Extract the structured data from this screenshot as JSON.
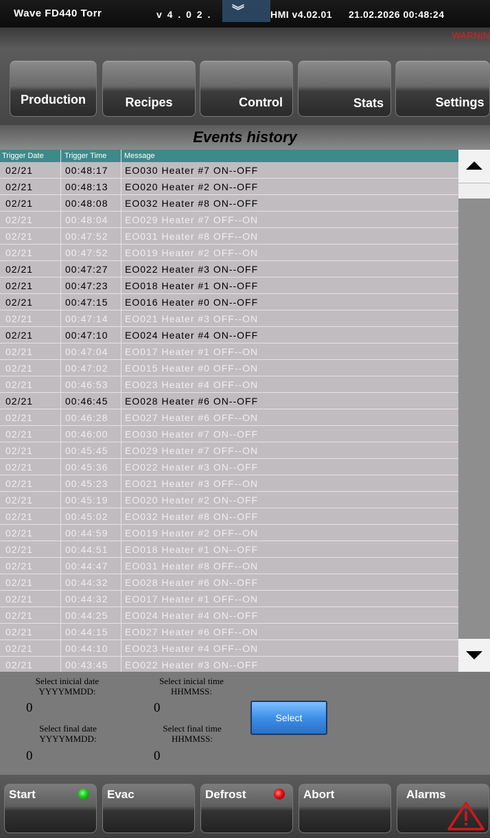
{
  "header": {
    "app_title": "Wave FD440 Torr",
    "version": "v 4 .   0 2 .",
    "hmi_version": "HMI v4.02.01",
    "datetime": "21.02.2026 00:48:24",
    "warning": "WARNIN"
  },
  "nav": {
    "production": "Production",
    "recipes": "Recipes",
    "control": "Control",
    "stats": "Stats",
    "settings": "Settings"
  },
  "page_title": "Events history",
  "table": {
    "columns": [
      "Trigger Date",
      "Trigger Time",
      "Message"
    ],
    "rows": [
      {
        "date": "02/21",
        "time": "00:48:17",
        "message": "EO030 Heater #7 ON--OFF",
        "state": "on"
      },
      {
        "date": "02/21",
        "time": "00:48:13",
        "message": "EO020 Heater #2 ON--OFF",
        "state": "on"
      },
      {
        "date": "02/21",
        "time": "00:48:08",
        "message": "EO032 Heater #8 ON--OFF",
        "state": "on"
      },
      {
        "date": "02/21",
        "time": "00:48:04",
        "message": "EO029 Heater #7 OFF--ON",
        "state": "off"
      },
      {
        "date": "02/21",
        "time": "00:47:52",
        "message": "EO031 Heater #8 OFF--ON",
        "state": "off"
      },
      {
        "date": "02/21",
        "time": "00:47:52",
        "message": "EO019 Heater #2 OFF--ON",
        "state": "off"
      },
      {
        "date": "02/21",
        "time": "00:47:27",
        "message": "EO022 Heater #3 ON--OFF",
        "state": "on"
      },
      {
        "date": "02/21",
        "time": "00:47:23",
        "message": "EO018 Heater #1 ON--OFF",
        "state": "on"
      },
      {
        "date": "02/21",
        "time": "00:47:15",
        "message": "EO016 Heater #0 ON--OFF",
        "state": "on"
      },
      {
        "date": "02/21",
        "time": "00:47:14",
        "message": "EO021 Heater #3 OFF--ON",
        "state": "off"
      },
      {
        "date": "02/21",
        "time": "00:47:10",
        "message": "EO024 Heater #4 ON--OFF",
        "state": "on"
      },
      {
        "date": "02/21",
        "time": "00:47:04",
        "message": "EO017 Heater #1 OFF--ON",
        "state": "off"
      },
      {
        "date": "02/21",
        "time": "00:47:02",
        "message": "EO015 Heater #0 OFF--ON",
        "state": "off"
      },
      {
        "date": "02/21",
        "time": "00:46:53",
        "message": "EO023 Heater #4 OFF--ON",
        "state": "off"
      },
      {
        "date": "02/21",
        "time": "00:46:45",
        "message": "EO028 Heater #6 ON--OFF",
        "state": "on"
      },
      {
        "date": "02/21",
        "time": "00:46:28",
        "message": "EO027 Heater #6 OFF--ON",
        "state": "off"
      },
      {
        "date": "02/21",
        "time": "00:46:00",
        "message": "EO030 Heater #7 ON--OFF",
        "state": "off"
      },
      {
        "date": "02/21",
        "time": "00:45:45",
        "message": "EO029 Heater #7 OFF--ON",
        "state": "off"
      },
      {
        "date": "02/21",
        "time": "00:45:36",
        "message": "EO022 Heater #3 ON--OFF",
        "state": "off"
      },
      {
        "date": "02/21",
        "time": "00:45:23",
        "message": "EO021 Heater #3 OFF--ON",
        "state": "off"
      },
      {
        "date": "02/21",
        "time": "00:45:19",
        "message": "EO020 Heater #2 ON--OFF",
        "state": "off"
      },
      {
        "date": "02/21",
        "time": "00:45:02",
        "message": "EO032 Heater #8 ON--OFF",
        "state": "off"
      },
      {
        "date": "02/21",
        "time": "00:44:59",
        "message": "EO019 Heater #2 OFF--ON",
        "state": "off"
      },
      {
        "date": "02/21",
        "time": "00:44:51",
        "message": "EO018 Heater #1 ON--OFF",
        "state": "off"
      },
      {
        "date": "02/21",
        "time": "00:44:47",
        "message": "EO031 Heater #8 OFF--ON",
        "state": "off"
      },
      {
        "date": "02/21",
        "time": "00:44:32",
        "message": "EO028 Heater #6 ON--OFF",
        "state": "off"
      },
      {
        "date": "02/21",
        "time": "00:44:32",
        "message": "EO017 Heater #1 OFF--ON",
        "state": "off"
      },
      {
        "date": "02/21",
        "time": "00:44:25",
        "message": "EO024 Heater #4 ON--OFF",
        "state": "off"
      },
      {
        "date": "02/21",
        "time": "00:44:15",
        "message": "EO027 Heater #6 OFF--ON",
        "state": "off"
      },
      {
        "date": "02/21",
        "time": "00:44:10",
        "message": "EO023 Heater #4 OFF--ON",
        "state": "off"
      },
      {
        "date": "02/21",
        "time": "00:43:45",
        "message": "EO022 Heater #3 ON--OFF",
        "state": "off"
      }
    ]
  },
  "filter": {
    "start_date_label": "Select inicial date",
    "start_date_format": "YYYYMMDD:",
    "start_date_value": "0",
    "start_time_label": "Select inicial time",
    "start_time_format": "HHMMSS:",
    "start_time_value": "0",
    "end_date_label": "Select final date",
    "end_date_format": "YYYYMMDD:",
    "end_date_value": "0",
    "end_time_label": "Select final time",
    "end_time_format": "HHMMSS:",
    "end_time_value": "0",
    "select_label": "Select"
  },
  "bottom": {
    "start": "Start",
    "evac": "Evac",
    "defrost": "Defrost",
    "abort": "Abort",
    "alarms": "Alarms"
  },
  "icons": {
    "scroll_up": "triangle-up-icon",
    "scroll_down": "triangle-down-icon",
    "menu_toggle": "double-chevron-down-icon",
    "start_led": "green-led-icon",
    "defrost_led": "red-led-icon",
    "alarm": "warning-triangle-icon"
  },
  "colors": {
    "table_header": "#3c8a8a",
    "active_row_text": "#000000",
    "inactive_row_text": "#f1eff1",
    "warning": "#e02020",
    "select_button": "#3d8fe8"
  }
}
